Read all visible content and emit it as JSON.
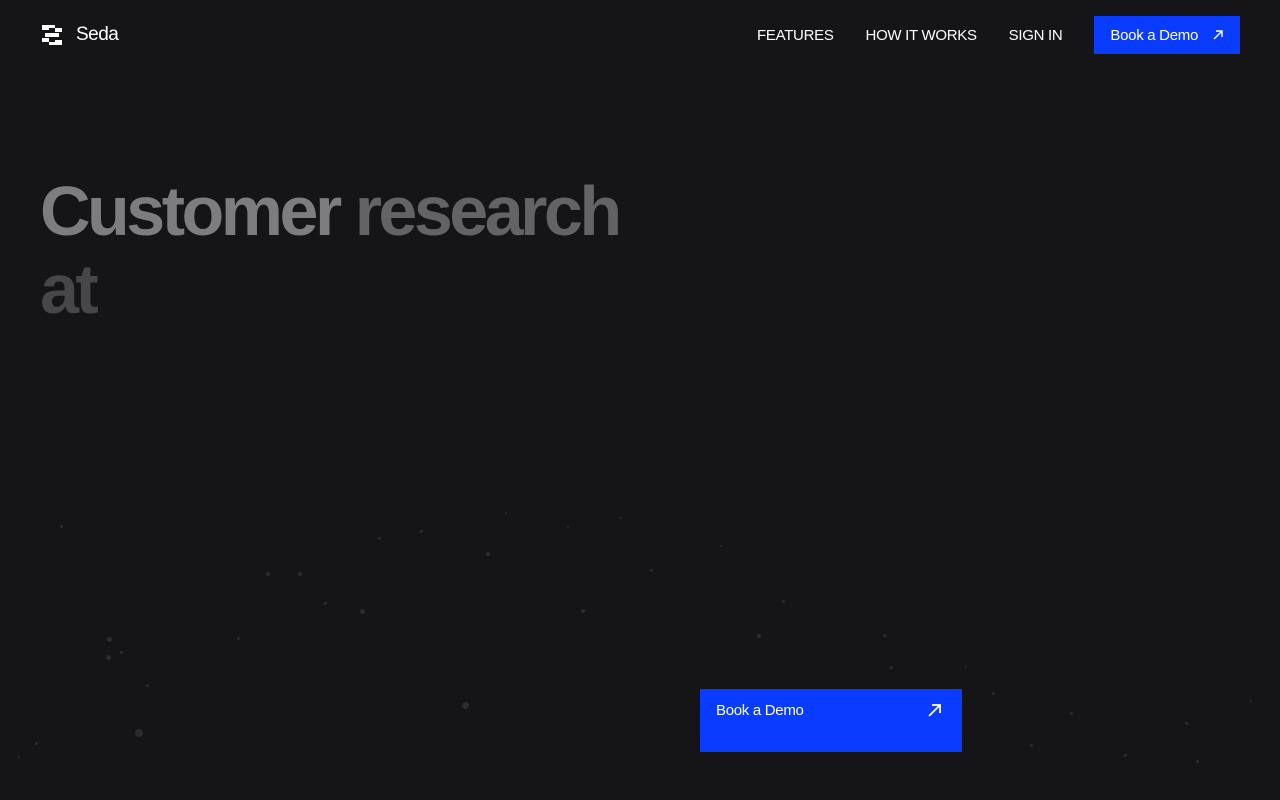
{
  "brand": {
    "name": "Seda",
    "icon": "seda-logo-icon"
  },
  "nav": {
    "links": [
      "FEATURES",
      "HOW IT WORKS",
      "SIGN IN"
    ],
    "cta_label": "Book a Demo",
    "cta_icon": "arrow-up-right-icon"
  },
  "hero": {
    "line1_word1": "Customer",
    "line1_word2": "research",
    "line2_word1": "at"
  },
  "cta": {
    "label": "Book a Demo",
    "icon": "arrow-up-right-icon"
  },
  "colors": {
    "accent": "#0a3cff",
    "background": "#151517"
  }
}
